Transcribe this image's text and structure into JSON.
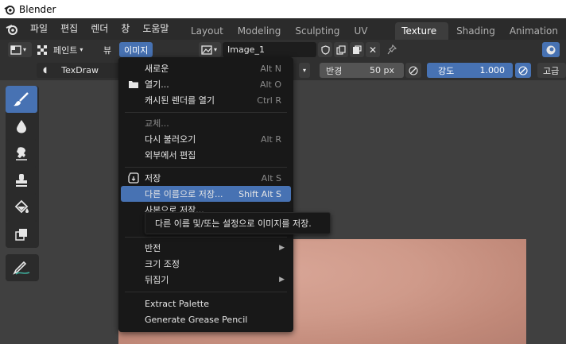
{
  "window": {
    "title": "Blender"
  },
  "topbar": {
    "menus": [
      "파일",
      "편집",
      "렌더",
      "창",
      "도움말"
    ],
    "workspaces": [
      {
        "label": "Layout",
        "active": false
      },
      {
        "label": "Modeling",
        "active": false
      },
      {
        "label": "Sculpting",
        "active": false
      },
      {
        "label": "UV Editing",
        "active": false
      },
      {
        "label": "Texture Paint",
        "active": true
      },
      {
        "label": "Shading",
        "active": false
      },
      {
        "label": "Animation",
        "active": false
      }
    ]
  },
  "editor_header": {
    "mode_label": "페인트",
    "view_label": "뷰",
    "image_menu_label": "이미지",
    "image_name": "Image_1"
  },
  "tool_header": {
    "brush_name": "TexDraw",
    "radius_label": "반경",
    "radius_value": "50 px",
    "strength_label": "강도",
    "strength_value": "1.000",
    "advanced_label": "고급"
  },
  "menu": {
    "items": [
      {
        "label": "새로운",
        "shortcut": "Alt N"
      },
      {
        "label": "열기...",
        "shortcut": "Alt O"
      },
      {
        "label": "캐시된 렌더를 열기",
        "shortcut": "Ctrl R"
      },
      {
        "label": "교체...",
        "shortcut": ""
      },
      {
        "label": "다시 불러오기",
        "shortcut": "Alt R"
      },
      {
        "label": "외부에서 편집",
        "shortcut": ""
      },
      {
        "label": "저장",
        "shortcut": "Alt S"
      },
      {
        "label": "다른 이름으로 저장...",
        "shortcut": "Shift Alt S"
      },
      {
        "label": "사본으로 저장...",
        "shortcut": ""
      },
      {
        "label": "반전",
        "shortcut": ""
      },
      {
        "label": "크기 조정",
        "shortcut": ""
      },
      {
        "label": "뒤집기",
        "shortcut": ""
      },
      {
        "label": "Extract Palette",
        "shortcut": ""
      },
      {
        "label": "Generate Grease Pencil",
        "shortcut": ""
      }
    ]
  },
  "tooltip": {
    "text": "다른 이름 및/또는 설정으로 이미지를 저장."
  },
  "colors": {
    "accent": "#4772b3",
    "menu_bg": "#181818",
    "header_bg": "#303030"
  }
}
